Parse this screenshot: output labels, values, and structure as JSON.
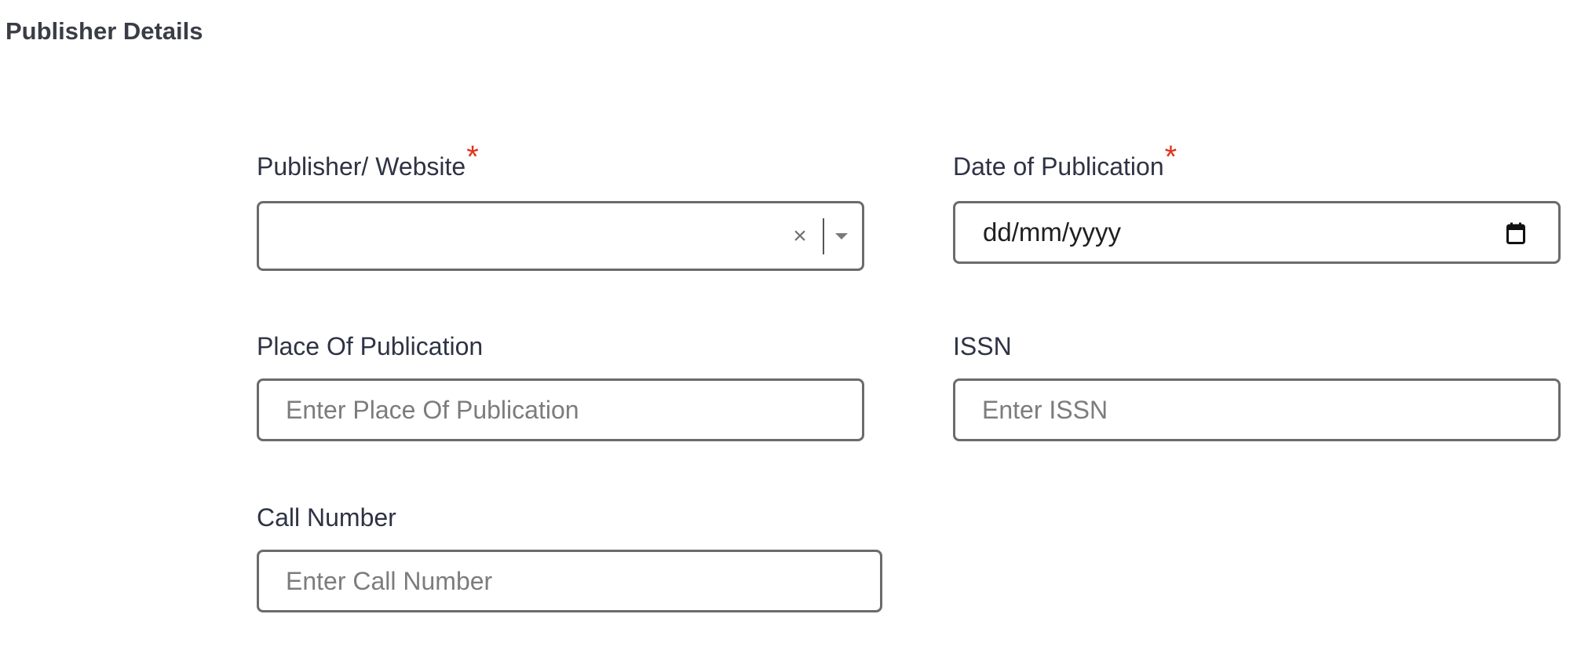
{
  "section": {
    "title": "Publisher Details"
  },
  "fields": {
    "publisher": {
      "label": "Publisher/ Website",
      "required_mark": "*",
      "value": "",
      "clear_glyph": "×",
      "clear_icon": "close-icon",
      "dropdown_icon": "chevron-down-icon"
    },
    "date": {
      "label": "Date of Publication",
      "required_mark": "*",
      "placeholder": "dd/mm/yyyy",
      "icon": "calendar-icon"
    },
    "place": {
      "label": "Place Of Publication",
      "placeholder": "Enter Place Of Publication"
    },
    "issn": {
      "label": "ISSN",
      "placeholder": "Enter ISSN"
    },
    "call_number": {
      "label": "Call Number",
      "placeholder": "Enter Call Number"
    }
  },
  "colors": {
    "required": "#e0321c",
    "border": "#6b6b6b",
    "label": "#2e3344",
    "placeholder": "#7c7c7c"
  }
}
